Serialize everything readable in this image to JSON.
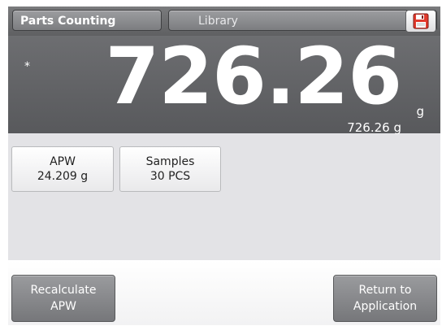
{
  "topbar": {
    "app_label": "Parts Counting",
    "library_label": "Library",
    "save_icon": "save-icon"
  },
  "display": {
    "stable_marker": "*",
    "main_weight": "726.26",
    "main_unit": "g",
    "secondary_weight": "726.26 g"
  },
  "cards": {
    "apw": {
      "title": "APW",
      "value": "24.209 g"
    },
    "samples": {
      "title": "Samples",
      "value": "30 PCS"
    }
  },
  "bottom": {
    "recalculate_line1": "Recalculate",
    "recalculate_line2": "APW",
    "return_line1": "Return to",
    "return_line2": "Application"
  },
  "colors": {
    "save_icon_red": "#e23a2d",
    "display_bg": "#5f6063"
  }
}
